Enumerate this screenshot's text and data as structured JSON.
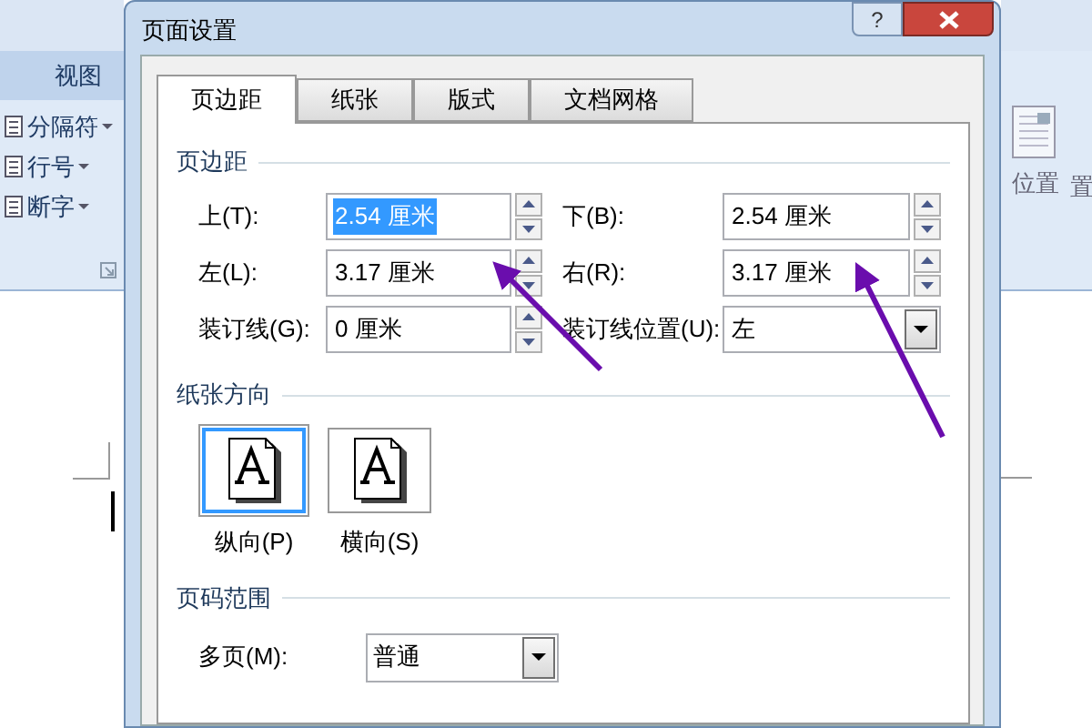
{
  "background_app": {
    "ribbon_tab": "视图",
    "commands": [
      "分隔符",
      "行号",
      "断字"
    ],
    "right_commands": [
      "位置",
      "置"
    ]
  },
  "window": {
    "title": "页面设置",
    "help_button": "?"
  },
  "tabs": [
    {
      "label": "页边距",
      "selected": true
    },
    {
      "label": "纸张",
      "selected": false
    },
    {
      "label": "版式",
      "selected": false
    },
    {
      "label": "文档网格",
      "selected": false
    }
  ],
  "margins": {
    "heading": "页边距",
    "fields": [
      {
        "label": "上(T):",
        "value": "2.54 厘米",
        "kind": "spin",
        "selected": true
      },
      {
        "label": "下(B):",
        "value": "2.54 厘米",
        "kind": "spin",
        "selected": false
      },
      {
        "label": "左(L):",
        "value": "3.17 厘米",
        "kind": "spin",
        "selected": false
      },
      {
        "label": "右(R):",
        "value": "3.17 厘米",
        "kind": "spin",
        "selected": false
      },
      {
        "label": "装订线(G):",
        "value": "0 厘米",
        "kind": "spin",
        "selected": false
      },
      {
        "label": "装订线位置(U):",
        "value": "左",
        "kind": "dropdown",
        "selected": false
      }
    ]
  },
  "orientation": {
    "heading": "纸张方向",
    "options": [
      {
        "label": "纵向(P)",
        "selected": true
      },
      {
        "label": "横向(S)",
        "selected": false
      }
    ]
  },
  "pages": {
    "heading": "页码范围",
    "label": "多页(M):",
    "value": "普通"
  }
}
